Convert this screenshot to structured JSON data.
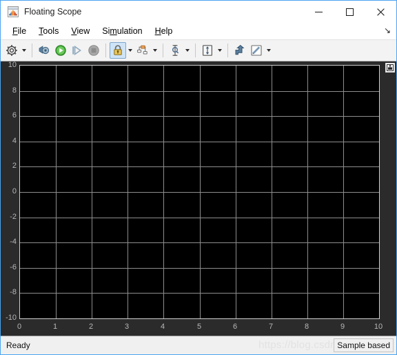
{
  "window": {
    "title": "Floating Scope",
    "app_icon": "matlab-scope-icon",
    "controls": {
      "minimize": "—",
      "maximize": "□",
      "close": "✕"
    }
  },
  "menubar": {
    "items": [
      {
        "label": "File",
        "mnemonic": "F",
        "rest": "ile"
      },
      {
        "label": "Tools",
        "mnemonic": "T",
        "rest": "ools"
      },
      {
        "label": "View",
        "mnemonic": "V",
        "rest": "iew"
      },
      {
        "label": "Simulation",
        "pre": "Si",
        "mnemonic": "m",
        "rest": "ulation"
      },
      {
        "label": "Help",
        "mnemonic": "H",
        "rest": "elp"
      }
    ],
    "undock_glyph": "↘"
  },
  "toolbar": {
    "groups": [
      {
        "name": "configuration",
        "buttons": [
          {
            "name": "configuration-properties-button",
            "icon": "gear-icon",
            "tooltip": "Configuration Properties",
            "has_dropdown": true,
            "active": false
          }
        ]
      },
      {
        "name": "simulation-control",
        "buttons": [
          {
            "name": "run-back-to-simulink-button",
            "icon": "simulink-run-icon",
            "tooltip": "Run",
            "has_dropdown": false,
            "active": false
          },
          {
            "name": "play-button",
            "icon": "play-icon",
            "tooltip": "Run",
            "has_dropdown": false,
            "active": false
          },
          {
            "name": "step-forward-button",
            "icon": "step-forward-icon",
            "tooltip": "Step Forward",
            "has_dropdown": false,
            "active": false
          },
          {
            "name": "stop-button",
            "icon": "stop-icon",
            "tooltip": "Stop",
            "has_dropdown": false,
            "active": false
          }
        ]
      },
      {
        "name": "data-lock",
        "buttons": [
          {
            "name": "lock-axes-button",
            "icon": "lock-icon",
            "tooltip": "Lock Axes",
            "has_dropdown": true,
            "active": true
          },
          {
            "name": "signal-selection-button",
            "icon": "signal-selector-icon",
            "tooltip": "Signal Selection",
            "has_dropdown": true,
            "active": false
          }
        ]
      },
      {
        "name": "cursor",
        "buttons": [
          {
            "name": "cursor-measurements-button",
            "icon": "cursor-measurement-icon",
            "tooltip": "Cursor Measurements",
            "has_dropdown": true,
            "active": false
          }
        ]
      },
      {
        "name": "scaling",
        "buttons": [
          {
            "name": "autoscale-button",
            "icon": "autoscale-icon",
            "tooltip": "Autoscale",
            "has_dropdown": true,
            "active": false
          }
        ]
      },
      {
        "name": "style",
        "buttons": [
          {
            "name": "share-export-button",
            "icon": "share-arrow-icon",
            "tooltip": "Share",
            "has_dropdown": false,
            "active": false
          },
          {
            "name": "style-button",
            "icon": "ruler-pencil-icon",
            "tooltip": "Style",
            "has_dropdown": true,
            "active": false
          }
        ]
      }
    ]
  },
  "scope": {
    "corner_button": {
      "name": "scope-legend-toggle",
      "icon": "legend-panel-icon"
    },
    "background": "#000000",
    "frame_background": "#2b2b2b",
    "grid_color": "#8e8e8e",
    "tick_color": "#b7b7b7"
  },
  "chart_data": {
    "type": "line",
    "title": "",
    "xlabel": "",
    "ylabel": "",
    "xlim": [
      0,
      10
    ],
    "ylim": [
      -10,
      10
    ],
    "xticks": [
      "0",
      "1",
      "2",
      "3",
      "4",
      "5",
      "6",
      "7",
      "8",
      "9",
      "10"
    ],
    "xtick_values": [
      0,
      1,
      2,
      3,
      4,
      5,
      6,
      7,
      8,
      9,
      10
    ],
    "yticks": [
      "10",
      "8",
      "6",
      "4",
      "2",
      "0",
      "-2",
      "-4",
      "-6",
      "-8",
      "-10"
    ],
    "ytick_values": [
      10,
      8,
      6,
      4,
      2,
      0,
      -2,
      -4,
      -6,
      -8,
      -10
    ],
    "grid": true,
    "legend": null,
    "series": [],
    "note": "Empty scope display - no signal data plotted"
  },
  "statusbar": {
    "status": "Ready",
    "mode": "Sample based",
    "watermark": "https://blog.csdn.net/ne"
  }
}
